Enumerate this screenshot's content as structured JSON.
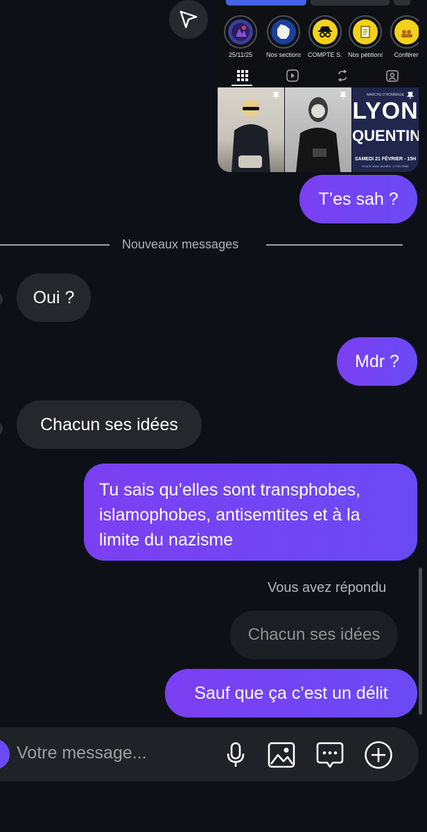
{
  "shared_post": {
    "highlights": [
      {
        "label": "25/11/25",
        "icon": "photo-highlight",
        "color": "#3b3f9a"
      },
      {
        "label": "Nos sections",
        "icon": "france-map-icon",
        "color": "#2a4fb0"
      },
      {
        "label": "COMPTE S...",
        "icon": "spy-icon",
        "color": "#f2d21b"
      },
      {
        "label": "Nos pétitions",
        "icon": "document-icon",
        "color": "#f2d21b"
      },
      {
        "label": "Conféren",
        "icon": "crowd-icon",
        "color": "#f2d21b"
      }
    ],
    "poster": {
      "small_top": "MARCHE D'HOMMAGE",
      "line1": "LYON",
      "line2": "QUENTIN",
      "date": "SAMEDI 21 FÉVRIER - 15H",
      "place": "PLACE JEAN JAURÈS - LYON 7ÈME"
    }
  },
  "divider": {
    "label": "Nouveaux messages"
  },
  "messages": {
    "m1": "T’es sah ?",
    "m2": "Oui ?",
    "m3": "Mdr ?",
    "m4": "Chacun ses idées",
    "m5_line1": "Tu sais qu’elles sont transphobes,",
    "m5_line2": "islamophobes, antisemtites et à la",
    "m5_line3": "limite du nazisme",
    "reply_label": "Vous avez répondu",
    "quoted": "Chacun ses idées",
    "m6": "Sauf que ça c’est un délit"
  },
  "composer": {
    "placeholder": "Votre message..."
  },
  "colors": {
    "accent": "#7443f4",
    "background": "#0d1117",
    "incoming": "#24272c"
  }
}
